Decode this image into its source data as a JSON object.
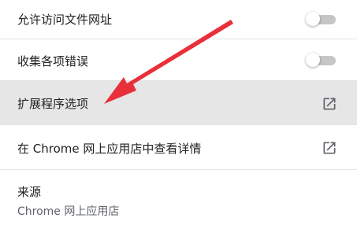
{
  "settings": {
    "allow_file_urls": {
      "label": "允许访问文件网址",
      "enabled": false
    },
    "collect_errors": {
      "label": "收集各项错误",
      "enabled": false
    },
    "extension_options": {
      "label": "扩展程序选项",
      "icon": "open-in-new-icon"
    },
    "view_in_store": {
      "label": "在 Chrome 网上应用店中查看详情",
      "icon": "open-in-new-icon"
    },
    "source": {
      "label": "来源",
      "value": "Chrome 网上应用店"
    }
  },
  "colors": {
    "highlight_row": "#e6e6e6",
    "arrow": "#e8303a",
    "toggle_track": "#c6c6c6",
    "icon": "#5f6368"
  }
}
